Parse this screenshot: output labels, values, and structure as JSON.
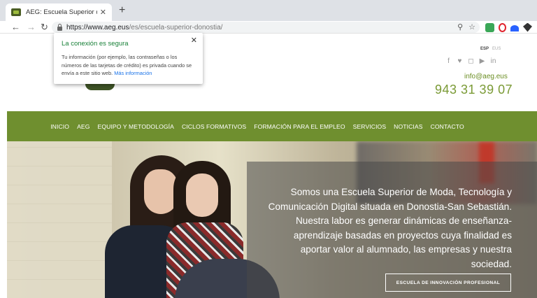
{
  "browser": {
    "tab_title": "AEG: Escuela Superior de Moda,",
    "tab_close": "✕",
    "new_tab": "+",
    "url_host": "https://www.aeg.eus",
    "url_path": "/es/escuela-superior-donostia/"
  },
  "security_popup": {
    "title": "La conexión es segura",
    "body": "Tu información (por ejemplo, las contraseñas o los números de las tarjetas de crédito) es privada cuando se envía a este sitio web.",
    "link": "Más información",
    "close": "✕"
  },
  "header": {
    "lang_active": "ESP",
    "lang_inactive": "EUS",
    "social_icons": [
      "facebook-icon",
      "twitter-icon",
      "instagram-icon",
      "youtube-icon",
      "linkedin-icon"
    ],
    "email": "info@aeg.eus",
    "phone": "943 31 39 07"
  },
  "nav": {
    "items": [
      "INICIO",
      "AEG",
      "EQUIPO Y METODOLOGÍA",
      "CICLOS FORMATIVOS",
      "FORMACIÓN PARA EL EMPLEO",
      "SERVICIOS",
      "NOTICIAS",
      "CONTACTO"
    ]
  },
  "hero": {
    "text": "Somos una Escuela Superior de Moda, Tecnología y Comunicación Digital situada en Donostia-San Sebastián. Nuestra labor es generar dinámicas de enseñanza-aprendizaje basadas en proyectos cuya finalidad es aportar valor al alumnado, las empresas y nuestra sociedad.",
    "button": "ESCUELA DE INNOVACIÓN PROFESIONAL"
  },
  "colors": {
    "brand_green": "#6f8f2f",
    "phone_green": "#7a9a35"
  }
}
